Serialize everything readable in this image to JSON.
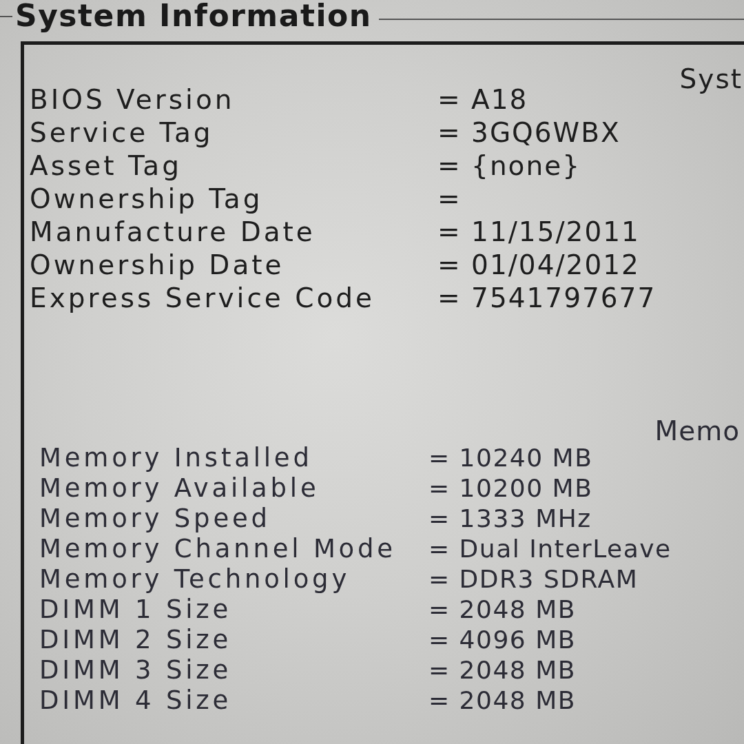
{
  "group_title": "System Information",
  "sections": [
    {
      "heading": "Syst",
      "rows": [
        {
          "label": "BIOS Version",
          "value": "= A18"
        },
        {
          "label": "Service Tag",
          "value": "= 3GQ6WBX"
        },
        {
          "label": "Asset Tag",
          "value": "= {none}"
        },
        {
          "label": "Ownership Tag",
          "value": "="
        },
        {
          "label": "Manufacture Date",
          "value": "= 11/15/2011"
        },
        {
          "label": "Ownership Date",
          "value": "= 01/04/2012"
        },
        {
          "label": "Express Service Code",
          "value": "= 7541797677"
        }
      ]
    },
    {
      "heading": "Memo",
      "rows": [
        {
          "label": "Memory Installed",
          "value": "= 10240 MB"
        },
        {
          "label": "Memory Available",
          "value": "= 10200 MB"
        },
        {
          "label": "Memory Speed",
          "value": "= 1333 MHz"
        },
        {
          "label": "Memory Channel Mode",
          "value": "= Dual InterLeave"
        },
        {
          "label": "Memory Technology",
          "value": "= DDR3 SDRAM"
        },
        {
          "label": "DIMM 1 Size",
          "value": "= 2048 MB"
        },
        {
          "label": "DIMM 2 Size",
          "value": "= 4096 MB"
        },
        {
          "label": "DIMM 3 Size",
          "value": "= 2048 MB"
        },
        {
          "label": "DIMM 4 Size",
          "value": "= 2048 MB"
        }
      ]
    }
  ]
}
